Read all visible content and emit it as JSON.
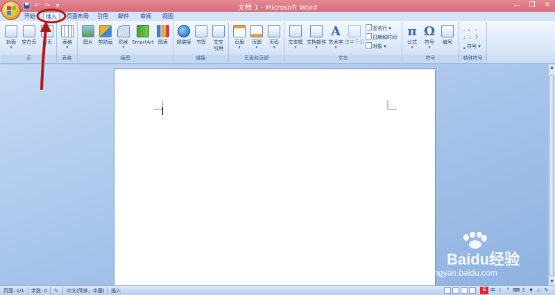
{
  "window": {
    "title": "文档 1 - Microsoft Word"
  },
  "qat": {
    "save_icon": "save-icon",
    "undo": "↶",
    "redo": "↷",
    "customize": "▾"
  },
  "tabs": [
    {
      "label": "开始"
    },
    {
      "label": "插入",
      "active": true
    },
    {
      "label": "页面布局"
    },
    {
      "label": "引用"
    },
    {
      "label": "邮件"
    },
    {
      "label": "审阅"
    },
    {
      "label": "视图"
    }
  ],
  "ribbon": {
    "groups": {
      "pages": {
        "label": "页",
        "cover": "封面",
        "blank": "空白页",
        "break": "分页"
      },
      "tables": {
        "label": "表格",
        "table": "表格"
      },
      "illustrations": {
        "label": "插图",
        "picture": "图片",
        "clipart": "剪贴画",
        "shapes": "形状",
        "smartart": "SmartArt",
        "chart": "图表"
      },
      "links": {
        "label": "链接",
        "hyperlink": "超链接",
        "bookmark": "书签",
        "crossref_1": "交叉",
        "crossref_2": "引用"
      },
      "header_footer": {
        "label": "页眉和页脚",
        "header": "页眉",
        "footer": "页脚",
        "page_number": "页码"
      },
      "text": {
        "label": "文本",
        "textbox": "文本框",
        "quickparts": "文档部件",
        "wordart": "艺术字",
        "dropcap": "首字下沉",
        "signature": "签名行",
        "datetime": "日期和时间",
        "object": "对象"
      },
      "symbols": {
        "label": "符号",
        "equation": "公式",
        "equation_glyph": "π",
        "symbol": "符号",
        "symbol_glyph": "Ω",
        "number": "编号"
      },
      "special": {
        "label": "特殊符号",
        "symbol": "符号",
        "row1": ", 。 、",
        "row2": "; : ?"
      }
    }
  },
  "status": {
    "page": "页面: 1/1",
    "words": "字数: 0",
    "language": "中文(简体，中国)",
    "mode": "插入"
  },
  "watermark": {
    "brand": "Baidu经验",
    "url": "jingyan.baidu.com"
  },
  "tray": {
    "ime_glyph": "S",
    "ime_lang": "中"
  },
  "colors": {
    "title_bar": "#d96a78",
    "ribbon": "#dde9f8",
    "annotation": "#b01818"
  }
}
